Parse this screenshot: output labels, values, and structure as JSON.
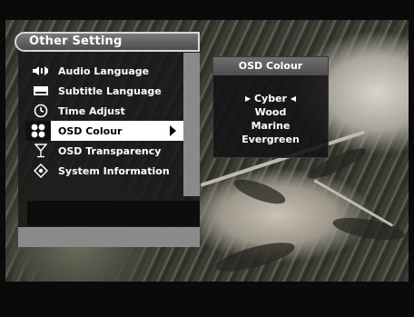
{
  "menu": {
    "title": "Other Setting",
    "items": [
      {
        "label": "Audio Language",
        "icon": "speaker-icon"
      },
      {
        "label": "Subtitle Language",
        "icon": "subtitle-icon"
      },
      {
        "label": "Time Adjust",
        "icon": "clock-icon"
      },
      {
        "label": "OSD Colour",
        "icon": "palette-icon",
        "selected": true
      },
      {
        "label": "OSD Transparency",
        "icon": "glass-icon"
      },
      {
        "label": "System Information",
        "icon": "info-diamond-icon"
      }
    ]
  },
  "popup": {
    "title": "OSD Colour",
    "options": [
      "Cyber",
      "Wood",
      "Marine",
      "Evergreen"
    ],
    "selected": "Cyber"
  }
}
